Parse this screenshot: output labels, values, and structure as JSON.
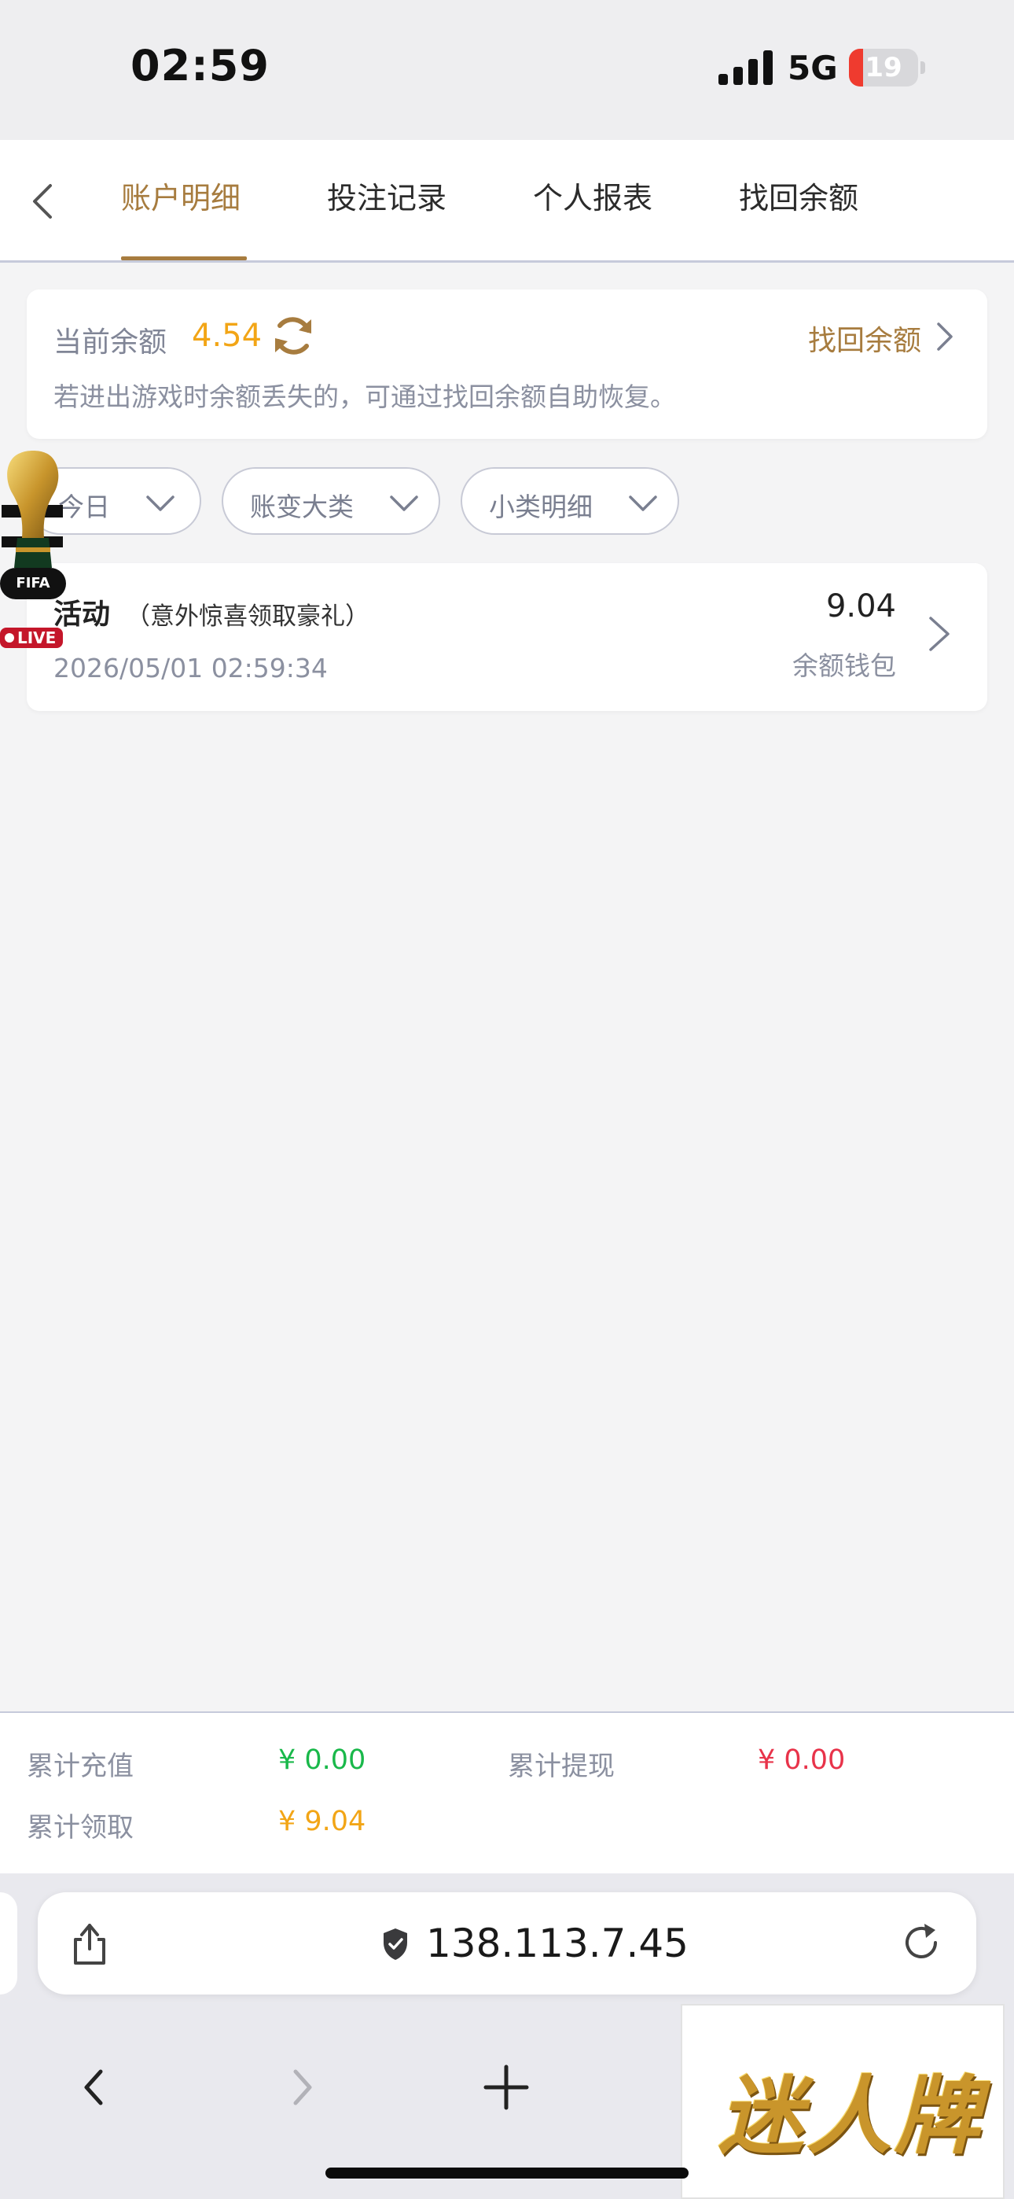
{
  "status_bar": {
    "time": "02:59",
    "network": "5G",
    "battery": "19"
  },
  "nav": {
    "tabs": [
      {
        "label": "账户明细",
        "active": true
      },
      {
        "label": "投注记录",
        "active": false
      },
      {
        "label": "个人报表",
        "active": false
      },
      {
        "label": "找回余额",
        "active": false
      }
    ]
  },
  "balance": {
    "label": "当前余额",
    "value": "4.54",
    "recover_label": "找回余额",
    "hint": "若进出游戏时余额丢失的，可通过找回余额自助恢复。"
  },
  "filters": [
    {
      "label": "今日"
    },
    {
      "label": "账变大类"
    },
    {
      "label": "小类明细"
    }
  ],
  "records": [
    {
      "title": "活动",
      "subtitle": "（意外惊喜领取豪礼）",
      "datetime": "2026/05/01 02:59:34",
      "amount": "9.04",
      "wallet": "余额钱包"
    }
  ],
  "fifa_badge": {
    "brand": "FIFA",
    "live": "LIVE"
  },
  "summary": {
    "deposit_label": "累计充值",
    "deposit_value": "¥ 0.00",
    "withdraw_label": "累计提现",
    "withdraw_value": "¥ 0.00",
    "claimed_label": "累计领取",
    "claimed_value": "¥ 9.04"
  },
  "browser": {
    "url": "138.113.7.45"
  },
  "promo": {
    "text": "迷人牌"
  },
  "colors": {
    "accent": "#a77c3f",
    "balance": "#f2a516",
    "green": "#19b84a",
    "red": "#e8334a"
  }
}
